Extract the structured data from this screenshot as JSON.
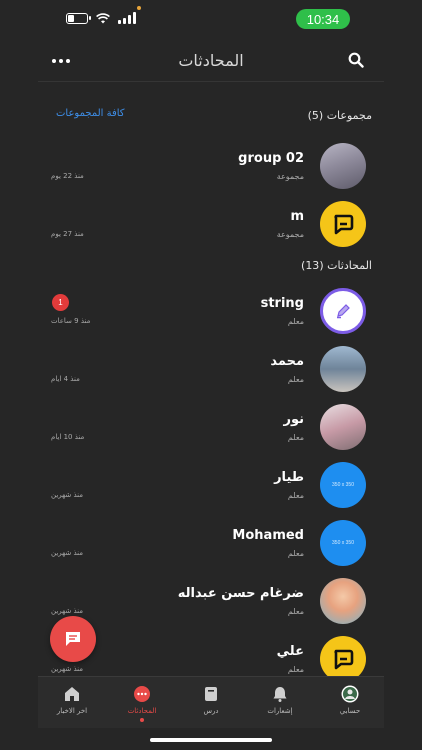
{
  "status_bar": {
    "time": "10:34"
  },
  "header": {
    "title": "المحادثات"
  },
  "groups_section": {
    "label": "مجموعات (5)",
    "all_link": "كافة المجموعات"
  },
  "groups": [
    {
      "name": "group 02",
      "subtitle": "مجموعة",
      "time": "منذ 22 يوم",
      "avatar": "photo1"
    },
    {
      "name": "m",
      "subtitle": "مجموعة",
      "time": "منذ 27 يوم",
      "avatar": "yellow-chat"
    }
  ],
  "chats_section": {
    "label": "المحادثات (13)"
  },
  "chats": [
    {
      "name": "string",
      "subtitle": "معلم",
      "time": "منذ 9 ساعات",
      "badge": "1",
      "avatar": "purple-pen"
    },
    {
      "name": "محمد",
      "subtitle": "معلم",
      "time": "منذ 4 ايام",
      "avatar": "photo2"
    },
    {
      "name": "نور",
      "subtitle": "معلم",
      "time": "منذ 10 ايام",
      "avatar": "photo3"
    },
    {
      "name": "طيار",
      "subtitle": "معلم",
      "time": "منذ شهرين",
      "avatar": "blue-placeholder",
      "avatar_text": "350 x 350"
    },
    {
      "name": "Mohamed",
      "subtitle": "معلم",
      "time": "منذ شهرين",
      "avatar": "blue-placeholder",
      "avatar_text": "350 x 350"
    },
    {
      "name": "ضرغام حسن عبداله",
      "subtitle": "معلم",
      "time": "منذ شهرين",
      "avatar": "cartoon"
    },
    {
      "name": "علي",
      "subtitle": "معلم",
      "time": "منذ شهرين",
      "avatar": "yellow-chat"
    }
  ],
  "nav": {
    "items": [
      {
        "label": "اخر الاخبار",
        "icon": "home-icon"
      },
      {
        "label": "المحادثات",
        "icon": "chat-dots-icon",
        "active": true
      },
      {
        "label": "درس",
        "icon": "book-icon"
      },
      {
        "label": "إشعارات",
        "icon": "bell-icon"
      },
      {
        "label": "حسابي",
        "icon": "profile-avatar-icon"
      }
    ]
  },
  "colors": {
    "accent": "#e84a48",
    "link": "#3e8ee8",
    "background": "#262626"
  }
}
